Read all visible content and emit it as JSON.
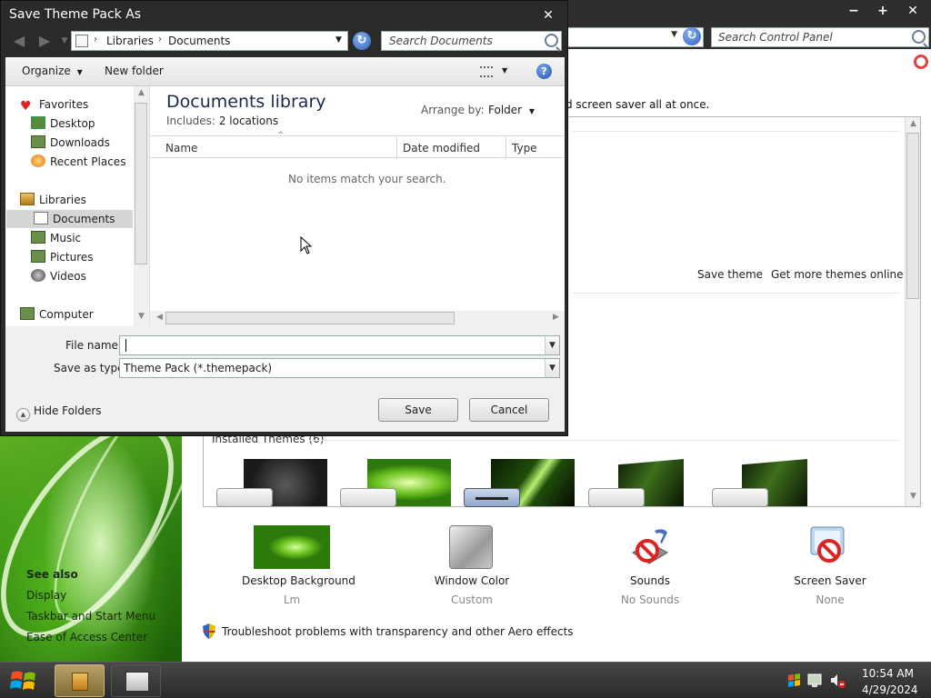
{
  "control_panel": {
    "window_buttons": {
      "minimize": "−",
      "maximize": "+",
      "close": "✕"
    },
    "search_placeholder": "Search Control Panel",
    "intro_text": "d screen saver all at once.",
    "save_theme": "Save theme",
    "get_more_themes": "Get more themes online",
    "installed_themes": "Installed Themes (6)",
    "see_also": {
      "heading": "See also",
      "links": [
        "Display",
        "Taskbar and Start Menu",
        "Ease of Access Center"
      ]
    },
    "bottom_items": [
      {
        "label": "Desktop Background",
        "value": "Lm"
      },
      {
        "label": "Window Color",
        "value": "Custom"
      },
      {
        "label": "Sounds",
        "value": "No Sounds"
      },
      {
        "label": "Screen Saver",
        "value": "None"
      }
    ],
    "troubleshoot_link": "Troubleshoot problems with transparency and other Aero effects"
  },
  "dialog": {
    "title": "Save Theme Pack As",
    "close_glyph": "✕",
    "breadcrumb": [
      "Libraries",
      "Documents"
    ],
    "search_placeholder": "Search Documents",
    "toolbar": {
      "organize": "Organize",
      "new_folder": "New folder",
      "help": "?"
    },
    "nav": {
      "favorites": "Favorites",
      "desktop": "Desktop",
      "downloads": "Downloads",
      "recent_places": "Recent Places",
      "libraries": "Libraries",
      "documents": "Documents",
      "music": "Music",
      "pictures": "Pictures",
      "videos": "Videos",
      "computer": "Computer"
    },
    "library_title": "Documents library",
    "includes_label": "Includes:",
    "includes_value": "2 locations",
    "arrange_by_label": "Arrange by:",
    "arrange_by_value": "Folder",
    "columns": [
      "Name",
      "Date modified",
      "Type"
    ],
    "empty_message": "No items match your search.",
    "file_name_label": "File name:",
    "file_name_value": "",
    "save_type_label": "Save as type:",
    "save_type_value": "Theme Pack (*.themepack)",
    "hide_folders": "Hide Folders",
    "save_button": "Save",
    "cancel_button": "Cancel"
  },
  "taskbar": {
    "time": "10:54 AM",
    "date": "4/29/2024"
  }
}
